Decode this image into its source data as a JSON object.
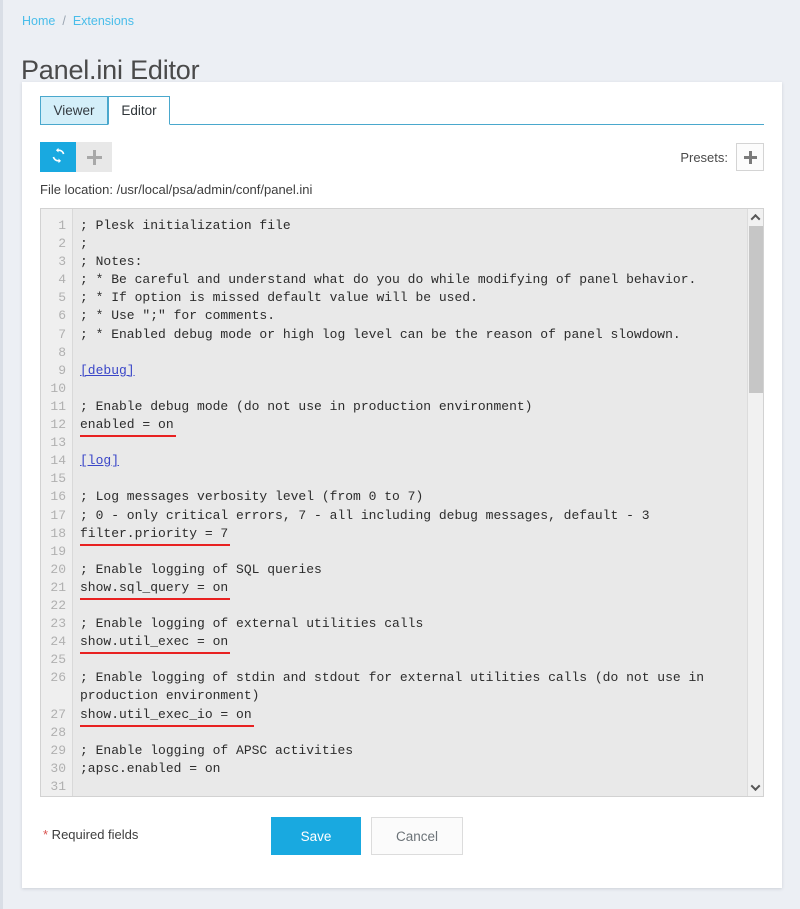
{
  "breadcrumb": {
    "items": [
      "Home",
      "Extensions"
    ],
    "separator": "/"
  },
  "page": {
    "title": "Panel.ini Editor"
  },
  "tabs": [
    {
      "label": "Viewer",
      "active": false
    },
    {
      "label": "Editor",
      "active": true
    }
  ],
  "toolbar": {
    "refresh_icon": "refresh-icon",
    "add_icon": "plus-icon",
    "presets_label": "Presets:",
    "presets_add_icon": "plus-icon"
  },
  "file_location": "File location: /usr/local/psa/admin/conf/panel.ini",
  "editor": {
    "line_numbers": [
      "1",
      "2",
      "3",
      "4",
      "5",
      "6",
      "7",
      "8",
      "9",
      "10",
      "11",
      "12",
      "13",
      "14",
      "15",
      "16",
      "17",
      "18",
      "19",
      "20",
      "21",
      "22",
      "23",
      "24",
      "25",
      "26",
      "",
      "27",
      "28",
      "29",
      "30",
      "31"
    ],
    "lines": [
      {
        "n": "1",
        "text": "; Plesk initialization file",
        "style": "plain"
      },
      {
        "n": "2",
        "text": ";",
        "style": "plain"
      },
      {
        "n": "3",
        "text": "; Notes:",
        "style": "plain"
      },
      {
        "n": "4",
        "text": "; * Be careful and understand what do you do while modifying of panel behavior.",
        "style": "plain"
      },
      {
        "n": "5",
        "text": "; * If option is missed default value will be used.",
        "style": "plain"
      },
      {
        "n": "6",
        "text": "; * Use \";\" for comments.",
        "style": "plain"
      },
      {
        "n": "7",
        "text": "; * Enabled debug mode or high log level can be the reason of panel slowdown.",
        "style": "plain"
      },
      {
        "n": "8",
        "text": "",
        "style": "plain"
      },
      {
        "n": "9",
        "text": "[debug]",
        "style": "section"
      },
      {
        "n": "10",
        "text": "",
        "style": "plain"
      },
      {
        "n": "11",
        "text": "; Enable debug mode (do not use in production environment)",
        "style": "plain"
      },
      {
        "n": "12",
        "text": "enabled = on",
        "style": "setting"
      },
      {
        "n": "13",
        "text": "",
        "style": "plain"
      },
      {
        "n": "14",
        "text": "[log]",
        "style": "section"
      },
      {
        "n": "15",
        "text": "",
        "style": "plain"
      },
      {
        "n": "16",
        "text": "; Log messages verbosity level (from 0 to 7)",
        "style": "plain"
      },
      {
        "n": "17",
        "text": "; 0 - only critical errors, 7 - all including debug messages, default - 3",
        "style": "plain"
      },
      {
        "n": "18",
        "text": "filter.priority = 7",
        "style": "setting"
      },
      {
        "n": "19",
        "text": "",
        "style": "plain"
      },
      {
        "n": "20",
        "text": "; Enable logging of SQL queries",
        "style": "plain"
      },
      {
        "n": "21",
        "text": "show.sql_query = on",
        "style": "setting"
      },
      {
        "n": "22",
        "text": "",
        "style": "plain"
      },
      {
        "n": "23",
        "text": "; Enable logging of external utilities calls",
        "style": "plain"
      },
      {
        "n": "24",
        "text": "show.util_exec = on",
        "style": "setting"
      },
      {
        "n": "25",
        "text": "",
        "style": "plain"
      },
      {
        "n": "26",
        "text": "; Enable logging of stdin and stdout for external utilities calls (do not use in",
        "style": "plain"
      },
      {
        "n": "",
        "text": "production environment)",
        "style": "plain"
      },
      {
        "n": "27",
        "text": "show.util_exec_io = on",
        "style": "setting"
      },
      {
        "n": "28",
        "text": "",
        "style": "plain"
      },
      {
        "n": "29",
        "text": "; Enable logging of APSC activities",
        "style": "plain"
      },
      {
        "n": "30",
        "text": ";apsc.enabled = on",
        "style": "plain"
      },
      {
        "n": "31",
        "text": "",
        "style": "plain"
      }
    ],
    "scrollbar": {
      "up_icon": "chevron-up-icon",
      "down_icon": "chevron-down-icon"
    }
  },
  "footer": {
    "required_star": "*",
    "required_text": " Required fields",
    "save_label": "Save",
    "cancel_label": "Cancel"
  },
  "colors": {
    "accent": "#19a9e0",
    "link": "#49bdea",
    "tab_border": "#4aa8cd",
    "tab_inactive_bg": "#d4eff9",
    "underline_red": "#e82121",
    "section_blue": "#3a46c8",
    "page_bg": "#eceff4"
  }
}
